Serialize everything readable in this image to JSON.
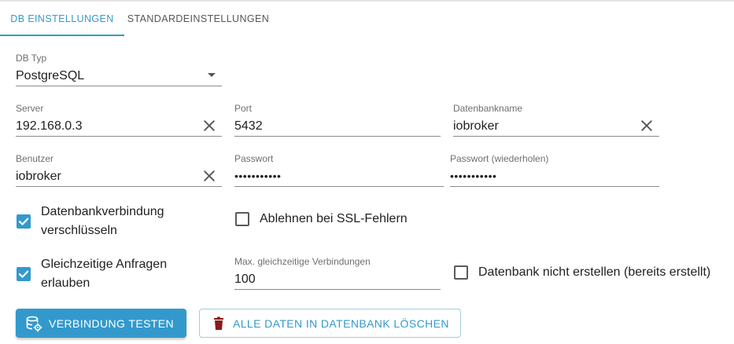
{
  "tabs": [
    {
      "label": "DB EINSTELLUNGEN",
      "active": true
    },
    {
      "label": "STANDARDEINSTELLUNGEN",
      "active": false
    }
  ],
  "db_type": {
    "label": "DB Typ",
    "value": "PostgreSQL"
  },
  "server": {
    "label": "Server",
    "value": "192.168.0.3"
  },
  "port": {
    "label": "Port",
    "value": "5432"
  },
  "dbname": {
    "label": "Datenbankname",
    "value": "iobroker"
  },
  "user": {
    "label": "Benutzer",
    "value": "iobroker"
  },
  "password": {
    "label": "Passwort",
    "value": "•••••••••••"
  },
  "password_repeat": {
    "label": "Passwort (wiederholen)",
    "value": "•••••••••••"
  },
  "checkboxes": {
    "encrypt": {
      "line1": "Datenbankverbindung",
      "line2": "verschlüsseln",
      "checked": true
    },
    "reject_ssl": {
      "label": "Ablehnen bei SSL-Fehlern",
      "checked": false
    },
    "parallel": {
      "line1": "Gleichzeitige Anfragen",
      "line2": "erlauben",
      "checked": true
    },
    "no_create": {
      "label": "Datenbank nicht erstellen (bereits erstellt)",
      "checked": false
    }
  },
  "max_connections": {
    "label": "Max. gleichzeitige Verbindungen",
    "value": "100"
  },
  "buttons": {
    "test": "VERBINDUNG TESTEN",
    "delete": "ALLE DATEN IN DATENBANK LÖSCHEN"
  },
  "icons": {
    "clear": "close-icon",
    "dropdown": "caret-down-icon",
    "test": "database-settings-icon",
    "delete": "trash-icon"
  },
  "colors": {
    "accent": "#3399cc",
    "delete_icon": "#8b1a1a"
  }
}
